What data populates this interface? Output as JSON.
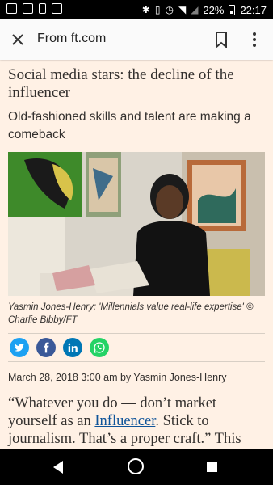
{
  "status_bar": {
    "battery_percent": "22%",
    "time": "22:17",
    "icons": [
      "image-icon",
      "gallery-icon",
      "battery-saver-icon",
      "screen-icon",
      "bluetooth-icon",
      "vibrate-icon",
      "alarm-icon",
      "wifi-icon",
      "signal-icon",
      "battery-icon"
    ]
  },
  "toolbar": {
    "title": "From ft.com",
    "icons": [
      "close-icon",
      "bookmark-icon",
      "more-vert-icon"
    ]
  },
  "article": {
    "headline": "Social media stars: the decline of the influencer",
    "standfirst": "Old-fashioned skills and talent are making a comeback",
    "caption": "Yasmin Jones-Henry: 'Millennials value real-life expertise' © Charlie Bibby/FT",
    "byline": "March 28, 2018 3:00 am by Yasmin Jones-Henry",
    "body_before_link": "“Whatever you do — don’t market yourself as an ",
    "body_link": "Influencer",
    "body_after_link": ". Stick to journalism. That’s a proper craft.” This"
  },
  "share": {
    "buttons": [
      "twitter",
      "facebook",
      "linkedin",
      "whatsapp"
    ],
    "colors": {
      "twitter": "#1da1f2",
      "facebook": "#3b5998",
      "linkedin": "#0077b5",
      "whatsapp": "#25d366"
    }
  },
  "nav_bar": {
    "icons": [
      "back-icon",
      "home-icon",
      "recents-icon"
    ]
  },
  "colors": {
    "page_background": "#fff1e5",
    "text": "#33302e",
    "link": "#0f5499"
  }
}
